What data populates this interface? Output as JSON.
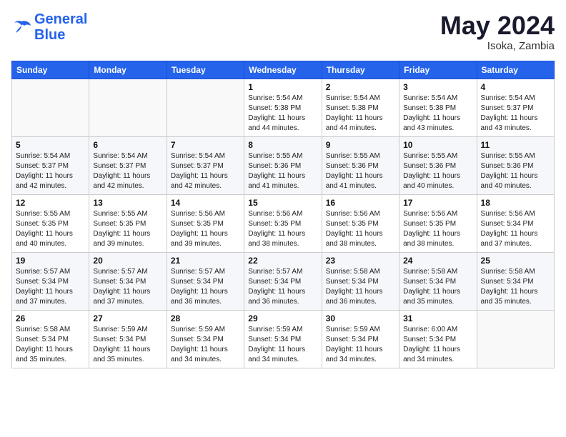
{
  "header": {
    "logo_line1": "General",
    "logo_line2": "Blue",
    "month_year": "May 2024",
    "location": "Isoka, Zambia"
  },
  "weekdays": [
    "Sunday",
    "Monday",
    "Tuesday",
    "Wednesday",
    "Thursday",
    "Friday",
    "Saturday"
  ],
  "weeks": [
    [
      {
        "day": "",
        "info": ""
      },
      {
        "day": "",
        "info": ""
      },
      {
        "day": "",
        "info": ""
      },
      {
        "day": "1",
        "info": "Sunrise: 5:54 AM\nSunset: 5:38 PM\nDaylight: 11 hours\nand 44 minutes."
      },
      {
        "day": "2",
        "info": "Sunrise: 5:54 AM\nSunset: 5:38 PM\nDaylight: 11 hours\nand 44 minutes."
      },
      {
        "day": "3",
        "info": "Sunrise: 5:54 AM\nSunset: 5:38 PM\nDaylight: 11 hours\nand 43 minutes."
      },
      {
        "day": "4",
        "info": "Sunrise: 5:54 AM\nSunset: 5:37 PM\nDaylight: 11 hours\nand 43 minutes."
      }
    ],
    [
      {
        "day": "5",
        "info": "Sunrise: 5:54 AM\nSunset: 5:37 PM\nDaylight: 11 hours\nand 42 minutes."
      },
      {
        "day": "6",
        "info": "Sunrise: 5:54 AM\nSunset: 5:37 PM\nDaylight: 11 hours\nand 42 minutes."
      },
      {
        "day": "7",
        "info": "Sunrise: 5:54 AM\nSunset: 5:37 PM\nDaylight: 11 hours\nand 42 minutes."
      },
      {
        "day": "8",
        "info": "Sunrise: 5:55 AM\nSunset: 5:36 PM\nDaylight: 11 hours\nand 41 minutes."
      },
      {
        "day": "9",
        "info": "Sunrise: 5:55 AM\nSunset: 5:36 PM\nDaylight: 11 hours\nand 41 minutes."
      },
      {
        "day": "10",
        "info": "Sunrise: 5:55 AM\nSunset: 5:36 PM\nDaylight: 11 hours\nand 40 minutes."
      },
      {
        "day": "11",
        "info": "Sunrise: 5:55 AM\nSunset: 5:36 PM\nDaylight: 11 hours\nand 40 minutes."
      }
    ],
    [
      {
        "day": "12",
        "info": "Sunrise: 5:55 AM\nSunset: 5:35 PM\nDaylight: 11 hours\nand 40 minutes."
      },
      {
        "day": "13",
        "info": "Sunrise: 5:55 AM\nSunset: 5:35 PM\nDaylight: 11 hours\nand 39 minutes."
      },
      {
        "day": "14",
        "info": "Sunrise: 5:56 AM\nSunset: 5:35 PM\nDaylight: 11 hours\nand 39 minutes."
      },
      {
        "day": "15",
        "info": "Sunrise: 5:56 AM\nSunset: 5:35 PM\nDaylight: 11 hours\nand 38 minutes."
      },
      {
        "day": "16",
        "info": "Sunrise: 5:56 AM\nSunset: 5:35 PM\nDaylight: 11 hours\nand 38 minutes."
      },
      {
        "day": "17",
        "info": "Sunrise: 5:56 AM\nSunset: 5:35 PM\nDaylight: 11 hours\nand 38 minutes."
      },
      {
        "day": "18",
        "info": "Sunrise: 5:56 AM\nSunset: 5:34 PM\nDaylight: 11 hours\nand 37 minutes."
      }
    ],
    [
      {
        "day": "19",
        "info": "Sunrise: 5:57 AM\nSunset: 5:34 PM\nDaylight: 11 hours\nand 37 minutes."
      },
      {
        "day": "20",
        "info": "Sunrise: 5:57 AM\nSunset: 5:34 PM\nDaylight: 11 hours\nand 37 minutes."
      },
      {
        "day": "21",
        "info": "Sunrise: 5:57 AM\nSunset: 5:34 PM\nDaylight: 11 hours\nand 36 minutes."
      },
      {
        "day": "22",
        "info": "Sunrise: 5:57 AM\nSunset: 5:34 PM\nDaylight: 11 hours\nand 36 minutes."
      },
      {
        "day": "23",
        "info": "Sunrise: 5:58 AM\nSunset: 5:34 PM\nDaylight: 11 hours\nand 36 minutes."
      },
      {
        "day": "24",
        "info": "Sunrise: 5:58 AM\nSunset: 5:34 PM\nDaylight: 11 hours\nand 35 minutes."
      },
      {
        "day": "25",
        "info": "Sunrise: 5:58 AM\nSunset: 5:34 PM\nDaylight: 11 hours\nand 35 minutes."
      }
    ],
    [
      {
        "day": "26",
        "info": "Sunrise: 5:58 AM\nSunset: 5:34 PM\nDaylight: 11 hours\nand 35 minutes."
      },
      {
        "day": "27",
        "info": "Sunrise: 5:59 AM\nSunset: 5:34 PM\nDaylight: 11 hours\nand 35 minutes."
      },
      {
        "day": "28",
        "info": "Sunrise: 5:59 AM\nSunset: 5:34 PM\nDaylight: 11 hours\nand 34 minutes."
      },
      {
        "day": "29",
        "info": "Sunrise: 5:59 AM\nSunset: 5:34 PM\nDaylight: 11 hours\nand 34 minutes."
      },
      {
        "day": "30",
        "info": "Sunrise: 5:59 AM\nSunset: 5:34 PM\nDaylight: 11 hours\nand 34 minutes."
      },
      {
        "day": "31",
        "info": "Sunrise: 6:00 AM\nSunset: 5:34 PM\nDaylight: 11 hours\nand 34 minutes."
      },
      {
        "day": "",
        "info": ""
      }
    ]
  ]
}
